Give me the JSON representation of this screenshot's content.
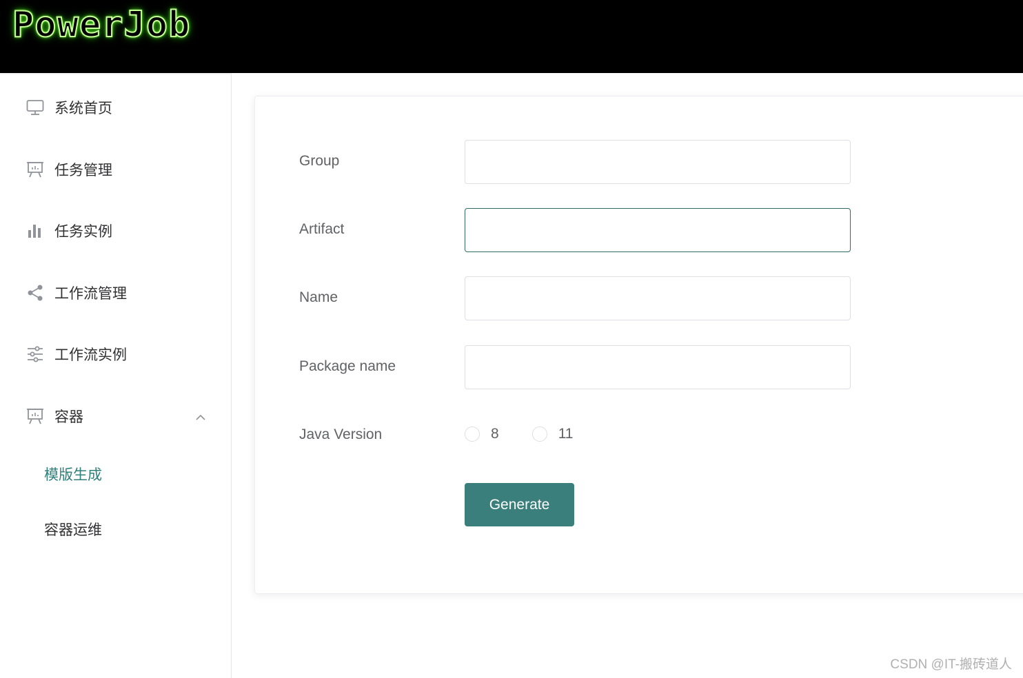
{
  "header": {
    "logo_text": "PowerJob"
  },
  "sidebar": {
    "items": [
      {
        "label": "系统首页",
        "icon": "monitor-icon"
      },
      {
        "label": "任务管理",
        "icon": "presentation-board-icon"
      },
      {
        "label": "任务实例",
        "icon": "bar-chart-icon"
      },
      {
        "label": "工作流管理",
        "icon": "share-nodes-icon"
      },
      {
        "label": "工作流实例",
        "icon": "sliders-icon"
      },
      {
        "label": "容器",
        "icon": "presentation-board-icon",
        "expanded": true
      }
    ],
    "submenu": [
      {
        "label": "模版生成",
        "active": true
      },
      {
        "label": "容器运维",
        "active": false
      }
    ]
  },
  "form": {
    "group_label": "Group",
    "group_value": "",
    "artifact_label": "Artifact",
    "artifact_value": "",
    "name_label": "Name",
    "name_value": "",
    "package_label": "Package name",
    "package_value": "",
    "java_version_label": "Java Version",
    "java_options": [
      "8",
      "11"
    ],
    "generate_label": "Generate"
  },
  "colors": {
    "accent": "#3a7f7b",
    "active_menu_text": "#2f7f7a",
    "header_bg": "#000000",
    "logo_glow": "#43d11b"
  },
  "watermark": "CSDN @IT-搬砖道人"
}
